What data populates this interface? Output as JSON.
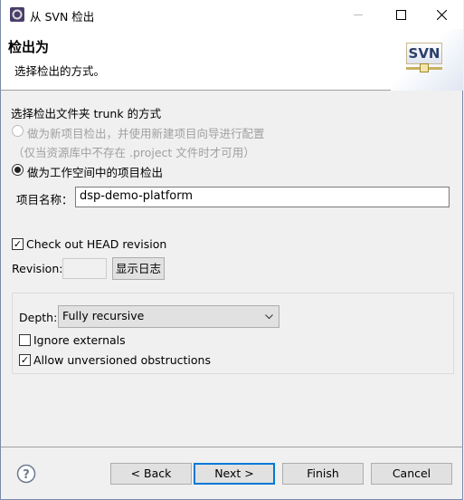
{
  "window": {
    "title": "从 SVN 检出"
  },
  "header": {
    "title": "检出为",
    "subtitle": "选择检出的方式。",
    "logo_text": "SVN"
  },
  "section": {
    "label": "选择检出文件夹 trunk 的方式",
    "option_new_project": "做为新项目检出，并使用新建项目向导进行配置",
    "option_new_project_note": "（仅当资源库中不存在 .project 文件时才可用）",
    "option_workspace": "做为工作空间中的项目检出",
    "selected": "option_workspace"
  },
  "project_name": {
    "label": "项目名称：",
    "value": "dsp-demo-platform"
  },
  "head_revision": {
    "label": "Check out HEAD revision",
    "checked": true
  },
  "revision": {
    "label": "Revision:",
    "value": "",
    "show_log": "显示日志"
  },
  "depth": {
    "label": "Depth:",
    "value": "Fully recursive"
  },
  "ignore_externals": {
    "label": "Ignore externals",
    "checked": false
  },
  "allow_unversioned": {
    "label": "Allow unversioned obstructions",
    "checked": true
  },
  "buttons": {
    "back": "< Back",
    "next": "Next >",
    "finish": "Finish",
    "cancel": "Cancel"
  },
  "colors": {
    "accent": "#0078d7"
  }
}
